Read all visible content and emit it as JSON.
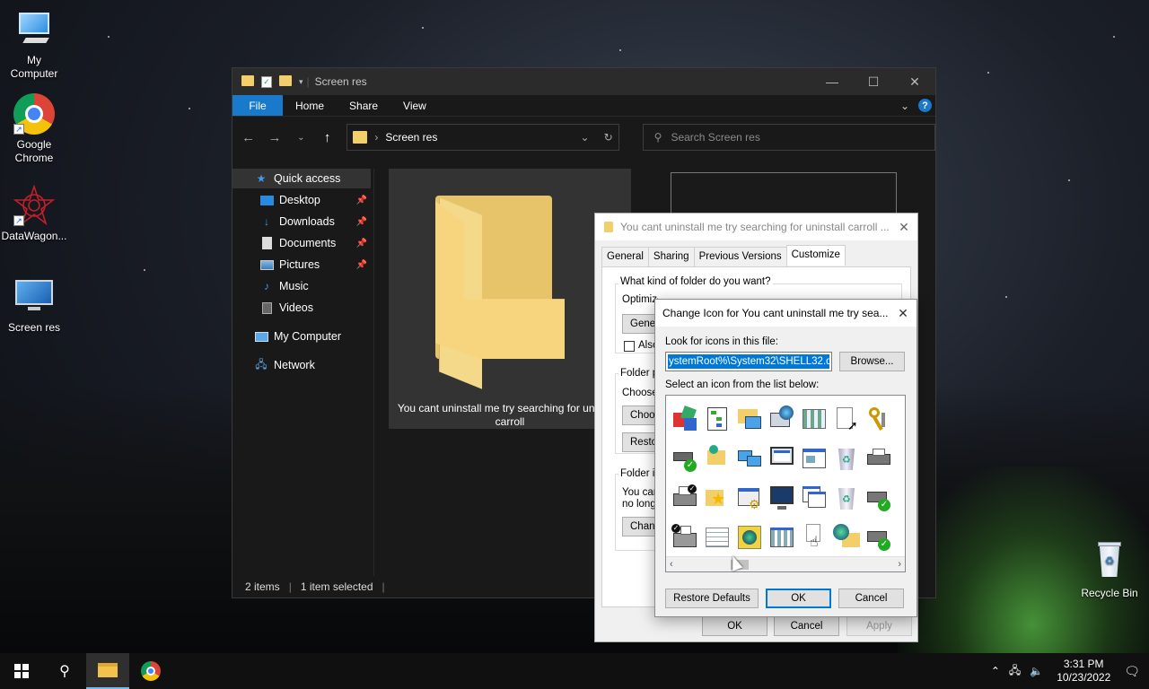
{
  "desktop": {
    "icons": [
      {
        "label": "My\nComputer"
      },
      {
        "label": "Google\nChrome"
      },
      {
        "label": "DataWagon..."
      },
      {
        "label": "Screen res"
      },
      {
        "label": "Recycle Bin"
      }
    ]
  },
  "explorer": {
    "title": "Screen res",
    "ribbon_tabs": [
      "File",
      "Home",
      "Share",
      "View"
    ],
    "address": "Screen res",
    "search_placeholder": "Search Screen res",
    "sidebar": [
      {
        "label": "Quick access",
        "icon": "star-icon"
      },
      {
        "label": "Desktop",
        "icon": "desktop-icon"
      },
      {
        "label": "Downloads",
        "icon": "download-icon"
      },
      {
        "label": "Documents",
        "icon": "document-icon"
      },
      {
        "label": "Pictures",
        "icon": "pictures-icon"
      },
      {
        "label": "Music",
        "icon": "music-icon"
      },
      {
        "label": "Videos",
        "icon": "videos-icon"
      },
      {
        "label": "My Computer",
        "icon": "computer-icon"
      },
      {
        "label": "Network",
        "icon": "network-icon"
      }
    ],
    "folder_label": "You cant uninstall me try searching for uninstall carroll",
    "status": {
      "items": "2 items",
      "selected": "1 item selected"
    }
  },
  "properties": {
    "title": "You cant uninstall me try searching for uninstall carroll ...",
    "tabs": [
      "General",
      "Sharing",
      "Previous Versions",
      "Customize"
    ],
    "kind_label": "What kind of folder do you want?",
    "optimize_label": "Optimize this folder for:",
    "optimize_value": "General items",
    "also_apply": "Also apply this template to all subfolders",
    "folder_pictures_label": "Folder pictures",
    "choose_label": "Choose a file to show on this folder icon.",
    "choose_file_btn": "Choose File...",
    "restore_default_btn": "Restore Default",
    "folder_icons_label": "Folder icons",
    "folder_icons_text_1": "You can change the folder icon. If you change it, the folder will",
    "folder_icons_text_2": "no longer show a preview of the folder's contents.",
    "change_icon_btn": "Change Icon...",
    "ok": "OK",
    "cancel": "Cancel",
    "apply": "Apply"
  },
  "change_icon": {
    "title": "Change Icon for You cant uninstall me try sea...",
    "look_label": "Look for icons in this file:",
    "file_value": "ystemRoot%\\System32\\SHELL32.dll",
    "browse": "Browse...",
    "select_label": "Select an icon from the list below:",
    "restore_defaults": "Restore Defaults",
    "ok": "OK",
    "cancel": "Cancel"
  },
  "taskbar": {
    "time": "3:31 PM",
    "date": "10/23/2022"
  },
  "colors": {
    "accent": "#1979ca",
    "folder": "#f7d57f",
    "selection": "#0078d7"
  }
}
